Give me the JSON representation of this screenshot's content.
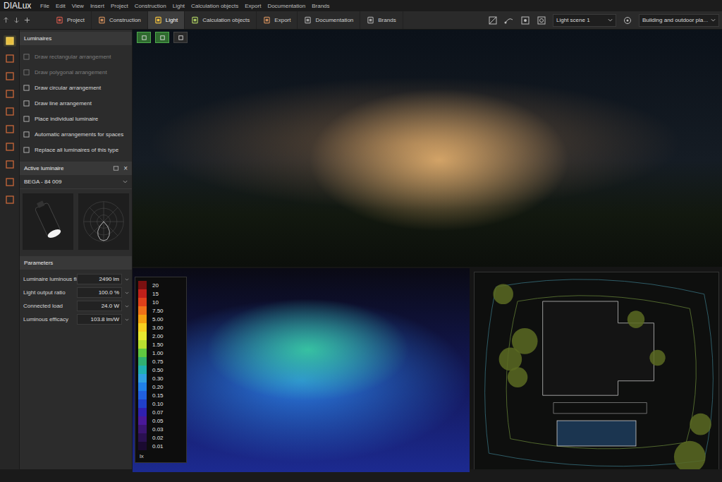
{
  "app": {
    "logo": "DIALux"
  },
  "menu": [
    "File",
    "Edit",
    "View",
    "Insert",
    "Project",
    "Construction",
    "Light",
    "Calculation objects",
    "Export",
    "Documentation",
    "Brands"
  ],
  "tabs": [
    {
      "label": "Project",
      "selected": false
    },
    {
      "label": "Construction",
      "selected": false
    },
    {
      "label": "Light",
      "selected": true
    },
    {
      "label": "Calculation objects",
      "selected": false
    },
    {
      "label": "Export",
      "selected": false
    },
    {
      "label": "Documentation",
      "selected": false
    },
    {
      "label": "Brands",
      "selected": false
    }
  ],
  "dropdowns": {
    "light_scene": "Light scene 1",
    "view": "Building and outdoor pla…"
  },
  "left_tools": [
    {
      "selected": true
    },
    {
      "selected": false
    },
    {
      "selected": false
    },
    {
      "selected": false
    },
    {
      "selected": false
    },
    {
      "selected": false
    },
    {
      "selected": false
    },
    {
      "selected": false
    },
    {
      "selected": false
    },
    {
      "selected": false
    }
  ],
  "view_tools": [
    {
      "selected": true
    },
    {
      "selected": true
    },
    {
      "selected": false
    }
  ],
  "luminaires_panel": {
    "title": "Luminaires",
    "items": [
      {
        "label": "Draw rectangular arrangement",
        "disabled": true
      },
      {
        "label": "Draw polygonal arrangement",
        "disabled": true
      },
      {
        "label": "Draw circular arrangement",
        "disabled": false
      },
      {
        "label": "Draw line arrangement",
        "disabled": false
      },
      {
        "label": "Place individual luminaire",
        "disabled": false
      },
      {
        "label": "Automatic arrangements for spaces",
        "disabled": false
      },
      {
        "label": "Replace all luminaires of this type",
        "disabled": false
      }
    ]
  },
  "active_luminaire": {
    "title": "Active luminaire",
    "close": "×",
    "name": "BEGA - 84 009"
  },
  "parameters": {
    "title": "Parameters",
    "rows": [
      {
        "label": "Luminaire luminous flux",
        "value": "2490 lm"
      },
      {
        "label": "Light output ratio",
        "value": "100.0 %"
      },
      {
        "label": "Connected load",
        "value": "24.0 W"
      },
      {
        "label": "Luminous efficacy",
        "value": "103.8 lm/W"
      }
    ]
  },
  "legend": {
    "unit": "lx",
    "steps": [
      {
        "value": "20",
        "color": "#7a1010"
      },
      {
        "value": "15",
        "color": "#c0201a"
      },
      {
        "value": "10",
        "color": "#e0401a"
      },
      {
        "value": "7.50",
        "color": "#f07018"
      },
      {
        "value": "5.00",
        "color": "#f5a010"
      },
      {
        "value": "3.00",
        "color": "#f8d020"
      },
      {
        "value": "2.00",
        "color": "#e8e830"
      },
      {
        "value": "1.50",
        "color": "#b8e030"
      },
      {
        "value": "1.00",
        "color": "#60c840"
      },
      {
        "value": "0.75",
        "color": "#30b070"
      },
      {
        "value": "0.50",
        "color": "#20b0b0"
      },
      {
        "value": "0.30",
        "color": "#30a0e0"
      },
      {
        "value": "0.20",
        "color": "#2080e8"
      },
      {
        "value": "0.15",
        "color": "#2060e0"
      },
      {
        "value": "0.10",
        "color": "#2040c8"
      },
      {
        "value": "0.07",
        "color": "#3020b0"
      },
      {
        "value": "0.05",
        "color": "#4a1898"
      },
      {
        "value": "0.03",
        "color": "#3a1470"
      },
      {
        "value": "0.02",
        "color": "#2a1050"
      },
      {
        "value": "0.01",
        "color": "#1a0a30"
      }
    ]
  }
}
